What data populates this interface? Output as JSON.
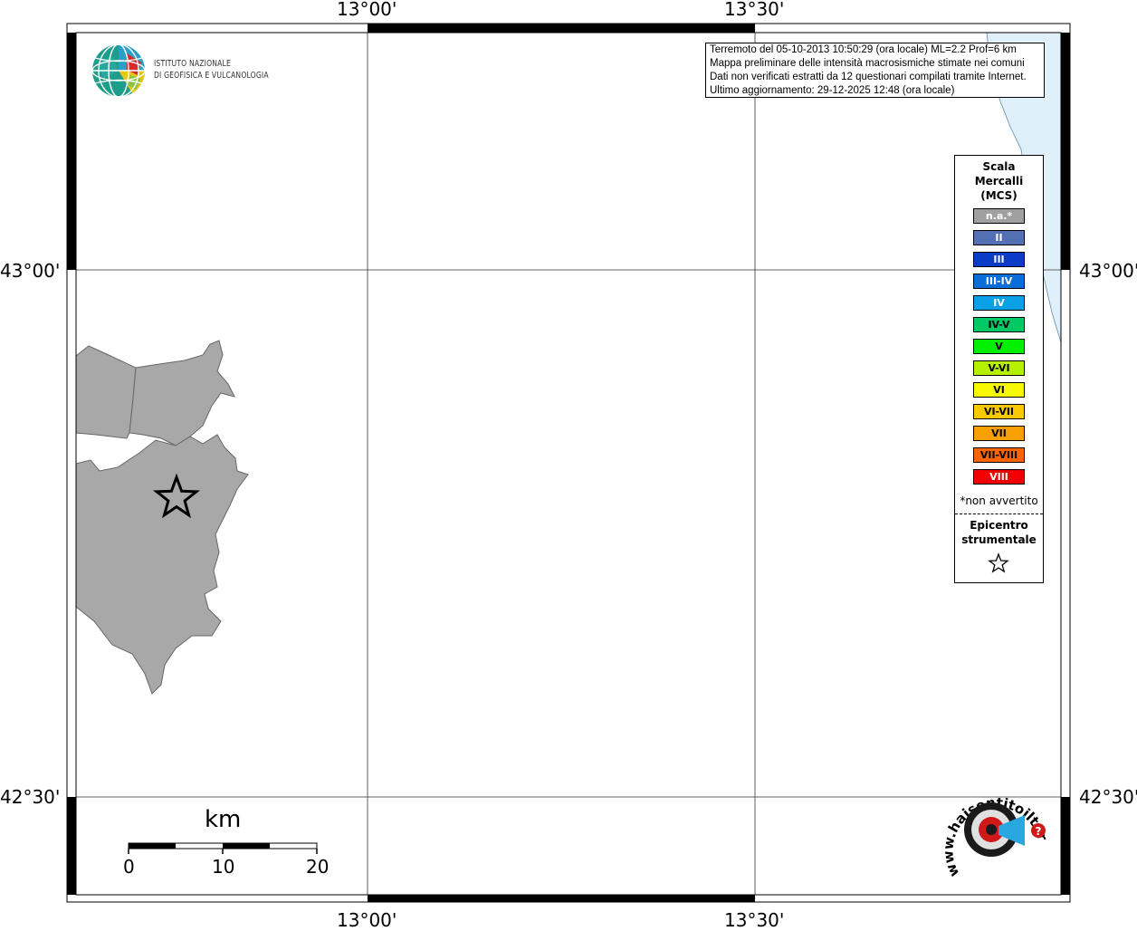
{
  "map": {
    "lon_labels": [
      "13°00'",
      "13°30'"
    ],
    "lat_labels": [
      "43°00'",
      "42°30'"
    ]
  },
  "logo": {
    "line1": "ISTITUTO NAZIONALE",
    "line2": "DI GEOFISICA E VULCANOLOGIA"
  },
  "info": {
    "line1": "Terremoto del 05-10-2013 10:50:29 (ora locale) ML=2.2 Prof=6 km",
    "line2": "Mappa preliminare delle intensità macrosismiche stimate nei comuni",
    "line3": "Dati non verificati estratti da 12 questionari compilati tramite Internet.",
    "line4": "Ultimo aggiornamento: 29-12-2025 12:48 (ora locale)"
  },
  "legend": {
    "title1": "Scala",
    "title2": "Mercalli",
    "title3": "(MCS)",
    "items": [
      {
        "label": "n.a.*",
        "color": "#a0a0a0",
        "text_color": "#ffffff"
      },
      {
        "label": "II",
        "color": "#5470b4",
        "text_color": "#ffffff"
      },
      {
        "label": "III",
        "color": "#0a3cc8",
        "text_color": "#ffffff"
      },
      {
        "label": "III-IV",
        "color": "#0a6ed8",
        "text_color": "#ffffff"
      },
      {
        "label": "IV",
        "color": "#0aa0e6",
        "text_color": "#ffffff"
      },
      {
        "label": "IV-V",
        "color": "#00c864",
        "text_color": "#000000"
      },
      {
        "label": "V",
        "color": "#00f000",
        "text_color": "#000000"
      },
      {
        "label": "V-VI",
        "color": "#b4f000",
        "text_color": "#000000"
      },
      {
        "label": "VI",
        "color": "#f8f800",
        "text_color": "#000000"
      },
      {
        "label": "VI-VII",
        "color": "#f8c800",
        "text_color": "#000000"
      },
      {
        "label": "VII",
        "color": "#f8a000",
        "text_color": "#000000"
      },
      {
        "label": "VII-VIII",
        "color": "#f86400",
        "text_color": "#000000"
      },
      {
        "label": "VIII",
        "color": "#f00000",
        "text_color": "#ffffff"
      }
    ],
    "note": "*non avvertito",
    "epi1": "Epicentro",
    "epi2": "strumentale"
  },
  "scalebar": {
    "unit": "km",
    "ticks": [
      "0",
      "10",
      "20"
    ]
  },
  "hsit": {
    "text": "www.haisentitoilterremoto.it",
    "question": "?"
  },
  "colors": {
    "municipality_fill": "#a8a8a8",
    "sea": "#e0f0fa"
  }
}
